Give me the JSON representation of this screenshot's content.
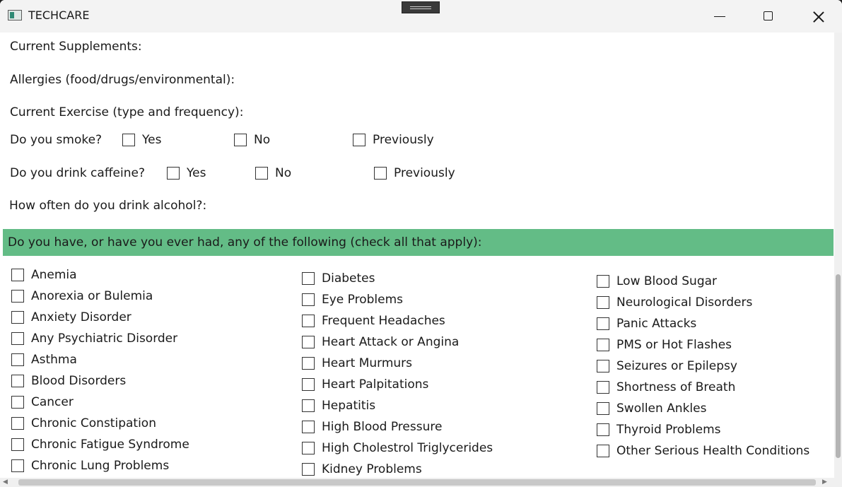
{
  "window": {
    "title": "TECHCARE"
  },
  "form": {
    "supplements_label": "Current Supplements:",
    "allergies_label": "Allergies (food/drugs/environmental):",
    "exercise_label": "Current Exercise (type and frequency):",
    "smoke": {
      "label": "Do you smoke?",
      "options": [
        "Yes",
        "No",
        "Previously"
      ]
    },
    "caffeine": {
      "label": "Do you drink caffeine?",
      "options": [
        "Yes",
        "No",
        "Previously"
      ]
    },
    "alcohol_label": "How often do you drink alcohol?:"
  },
  "conditions": {
    "header": "Do you have, or have you ever had, any of the following (check all that apply):",
    "column1": [
      "Anemia",
      "Anorexia or Bulemia",
      "Anxiety Disorder",
      "Any Psychiatric Disorder",
      "Asthma",
      "Blood Disorders",
      "Cancer",
      "Chronic Constipation",
      "Chronic Fatigue Syndrome",
      "Chronic Lung Problems"
    ],
    "column2": [
      "Diabetes",
      "Eye Problems",
      "Frequent Headaches",
      "Heart Attack or Angina",
      "Heart Murmurs",
      "Heart Palpitations",
      "Hepatitis",
      "High Blood Pressure",
      "High Cholestrol Triglycerides",
      "Kidney Problems"
    ],
    "column3": [
      "Low Blood Sugar",
      "Neurological Disorders",
      "Panic Attacks",
      "PMS or Hot Flashes",
      "Seizures or Epilepsy",
      "Shortness of Breath",
      "Swollen Ankles",
      "Thyroid Problems",
      "Other Serious Health Conditions"
    ]
  },
  "theme": {
    "banner_color": "#63bc86",
    "accent_icon_color": "#2d8a74"
  },
  "icons": {
    "app": "app-window-icon",
    "minimize": "minimize-icon",
    "maximize": "maximize-icon",
    "close": "close-icon"
  }
}
